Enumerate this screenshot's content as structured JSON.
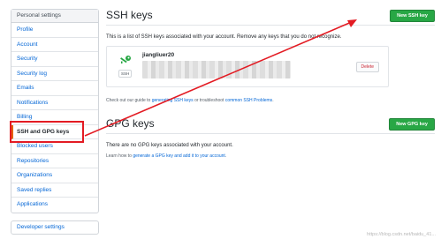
{
  "sidebar": {
    "header": "Personal settings",
    "items": [
      {
        "label": "Profile"
      },
      {
        "label": "Account"
      },
      {
        "label": "Security"
      },
      {
        "label": "Security log"
      },
      {
        "label": "Emails"
      },
      {
        "label": "Notifications"
      },
      {
        "label": "Billing"
      },
      {
        "label": "SSH and GPG keys",
        "selected": true
      },
      {
        "label": "Blocked users"
      },
      {
        "label": "Repositories"
      },
      {
        "label": "Organizations"
      },
      {
        "label": "Saved replies"
      },
      {
        "label": "Applications"
      }
    ],
    "developer_settings": "Developer settings"
  },
  "ssh": {
    "title": "SSH keys",
    "new_button": "New SSH key",
    "description": "This is a list of SSH keys associated with your account. Remove any keys that you do not recognize.",
    "key": {
      "name": "jiangliuer20",
      "type_badge": "SSH",
      "delete_label": "Delete"
    },
    "help_prefix": "Check out our guide to ",
    "help_link1": "generating SSH keys",
    "help_middle": " or troubleshoot ",
    "help_link2": "common SSH Problems",
    "help_suffix": "."
  },
  "gpg": {
    "title": "GPG keys",
    "new_button": "New GPG key",
    "empty_text": "There are no GPG keys associated with your account.",
    "help_prefix": "Learn how to ",
    "help_link": "generate a GPG key and add it to your account",
    "help_suffix": "."
  },
  "watermark": "https://blog.csdn.net/baidu_41...",
  "colors": {
    "accent_green": "#28a745",
    "link_blue": "#0366d6",
    "annotation_red": "#e31b23",
    "key_icon_green": "#28a745"
  }
}
